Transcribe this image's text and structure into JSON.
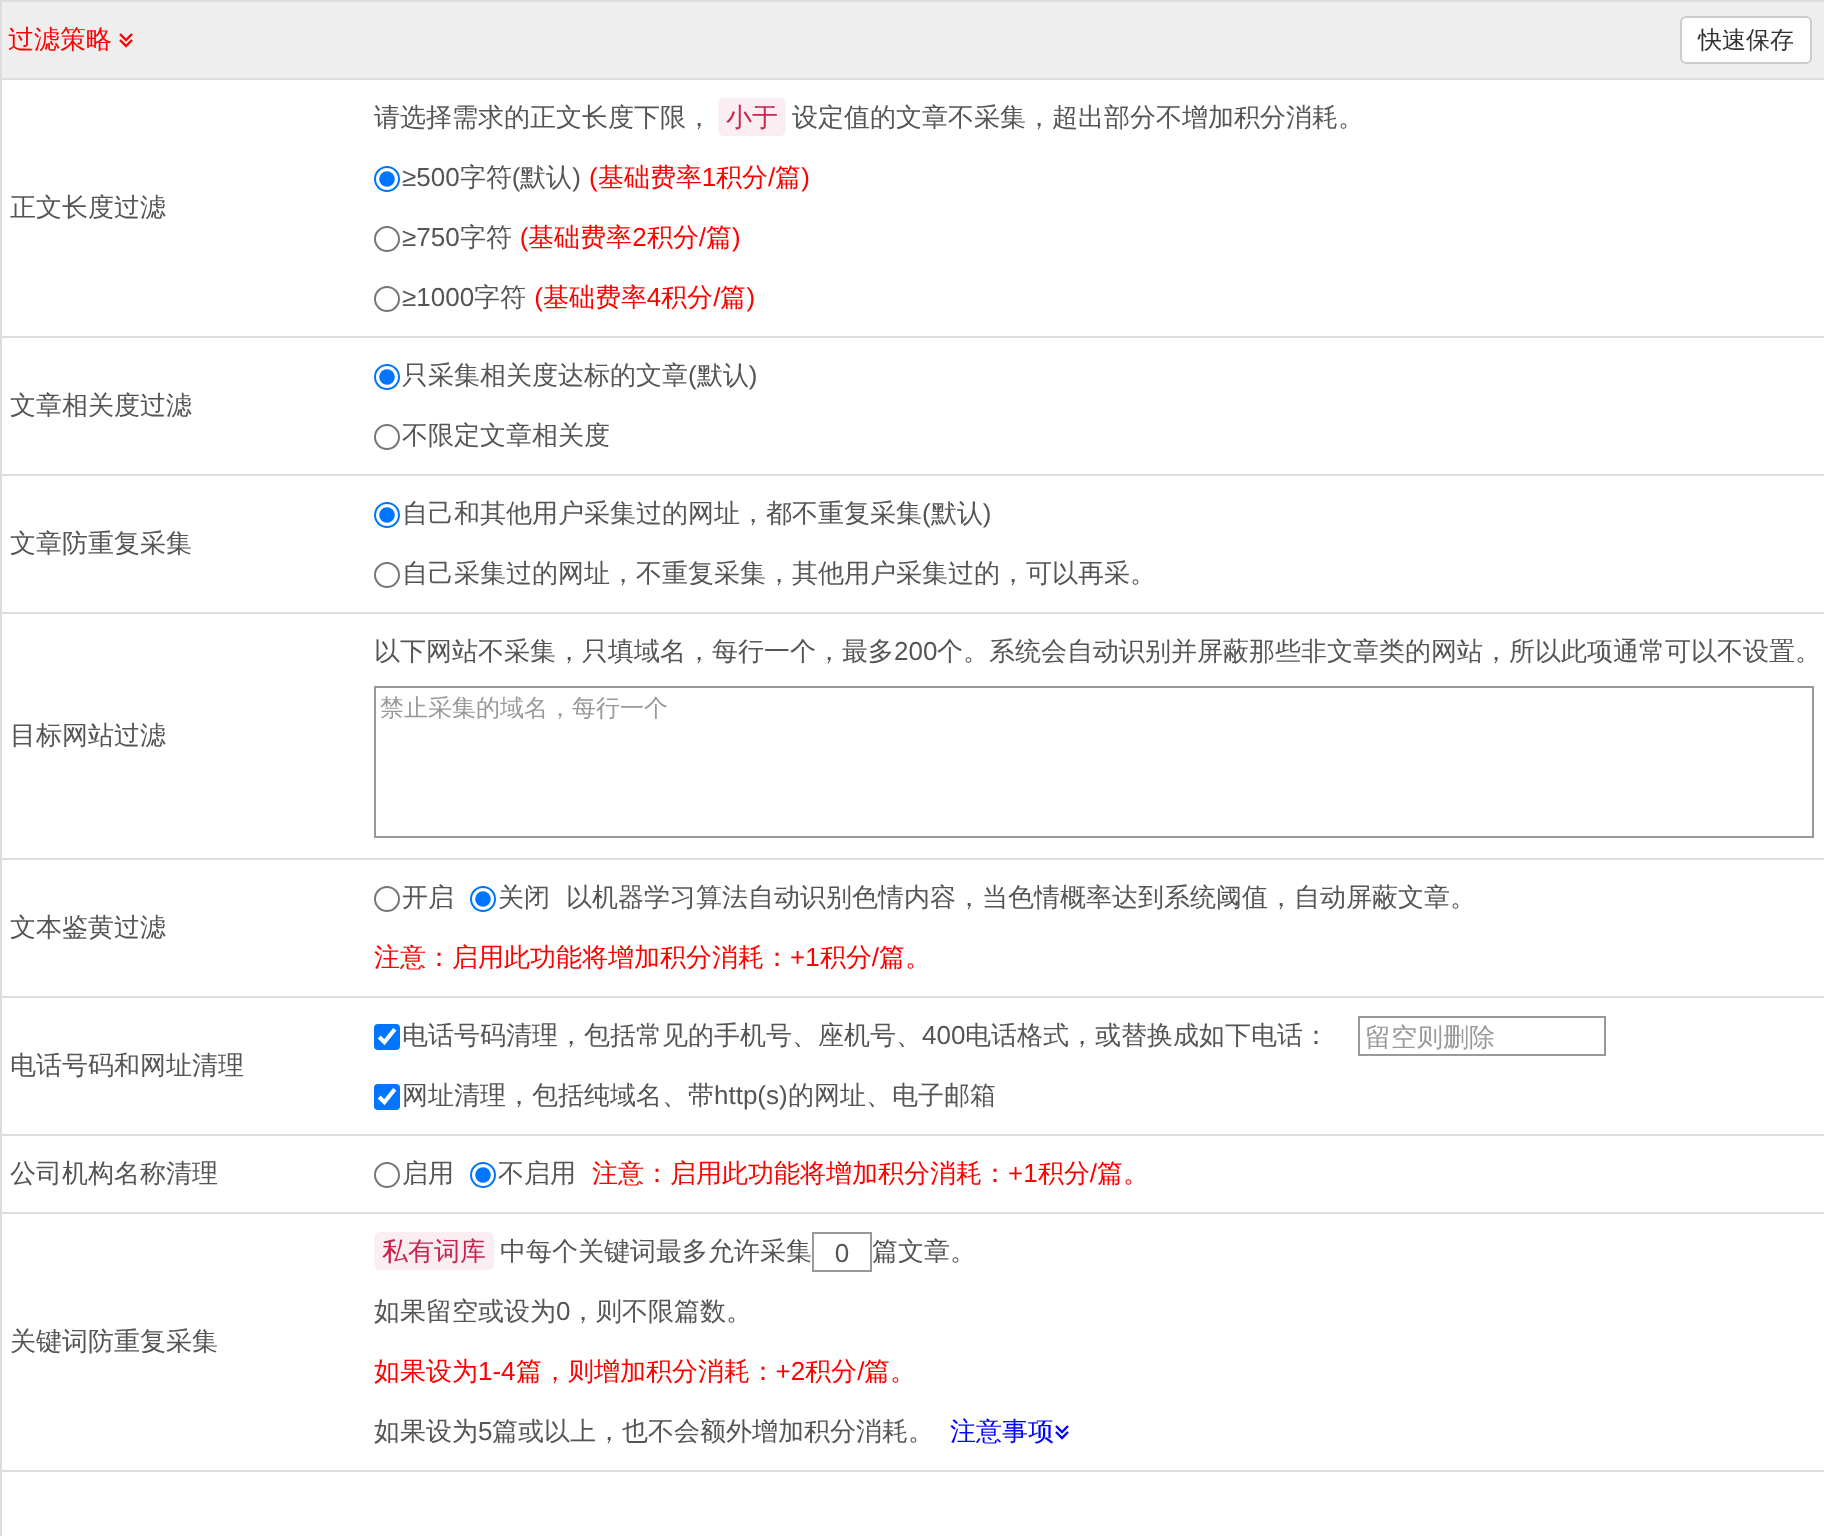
{
  "header": {
    "title": "过滤策略",
    "save_button": "快速保存"
  },
  "rows": [
    {
      "label": "正文长度过滤",
      "lines": [
        {
          "kind": "tagged",
          "before": "请选择需求的正文长度下限，",
          "tag": "小于",
          "after": "设定值的文章不采集，超出部分不增加积分消耗。"
        },
        {
          "kind": "radio",
          "label": "≥500字符(默认)",
          "note": "(基础费率1积分/篇)",
          "selected": true
        },
        {
          "kind": "radio",
          "label": "≥750字符",
          "note": "(基础费率2积分/篇)",
          "selected": false
        },
        {
          "kind": "radio",
          "label": "≥1000字符",
          "note": "(基础费率4积分/篇)",
          "selected": false
        }
      ]
    },
    {
      "label": "文章相关度过滤",
      "lines": [
        {
          "kind": "radio",
          "label": "只采集相关度达标的文章(默认)",
          "selected": true
        },
        {
          "kind": "radio",
          "label": "不限定文章相关度",
          "selected": false
        }
      ]
    },
    {
      "label": "文章防重复采集",
      "lines": [
        {
          "kind": "radio",
          "label": "自己和其他用户采集过的网址，都不重复采集(默认)",
          "selected": true
        },
        {
          "kind": "radio",
          "label": "自己采集过的网址，不重复采集，其他用户采集过的，可以再采。",
          "selected": false
        }
      ]
    },
    {
      "label": "目标网站过滤",
      "lines": [
        {
          "kind": "text",
          "text": "以下网站不采集，只填域名，每行一个，最多200个。系统会自动识别并屏蔽那些非文章类的网站，所以此项通常可以不设置。"
        },
        {
          "kind": "textarea",
          "placeholder": "禁止采集的域名，每行一个"
        }
      ]
    },
    {
      "label": "文本鉴黄过滤",
      "lines": [
        {
          "kind": "radios",
          "options": [
            {
              "label": "开启",
              "selected": false
            },
            {
              "label": "关闭",
              "selected": true
            }
          ],
          "text": "以机器学习算法自动识别色情内容，当色情概率达到系统阈值，自动屏蔽文章。"
        },
        {
          "kind": "warning",
          "text": "注意：启用此功能将增加积分消耗：+1积分/篇。"
        }
      ]
    },
    {
      "label": "电话号码和网址清理",
      "lines": [
        {
          "kind": "checkbox",
          "label": "电话号码清理，包括常见的手机号、座机号、400电话格式，或替换成如下电话：",
          "checked": true,
          "placeholder": "留空则删除"
        },
        {
          "kind": "checkbox",
          "label": "网址清理，包括纯域名、带http(s)的网址、电子邮箱",
          "checked": true
        }
      ]
    },
    {
      "label": "公司机构名称清理",
      "lines": [
        {
          "kind": "radios",
          "options": [
            {
              "label": "启用",
              "selected": false
            },
            {
              "label": "不启用",
              "selected": true
            }
          ],
          "note": "注意：启用此功能将增加积分消耗：+1积分/篇。"
        }
      ]
    },
    {
      "label": "关键词防重复采集",
      "lines": [
        {
          "kind": "quota",
          "tag": "私有词库",
          "before": "中每个关键词最多允许采集",
          "value": "0",
          "after": "篇文章。"
        },
        {
          "kind": "text",
          "text": "如果留空或设为0，则不限篇数。"
        },
        {
          "kind": "warning",
          "text": "如果设为1-4篇，则增加积分消耗：+2积分/篇。"
        },
        {
          "kind": "link",
          "text": "如果设为5篇或以上，也不会额外增加积分消耗。",
          "link": "注意事项"
        }
      ]
    }
  ]
}
